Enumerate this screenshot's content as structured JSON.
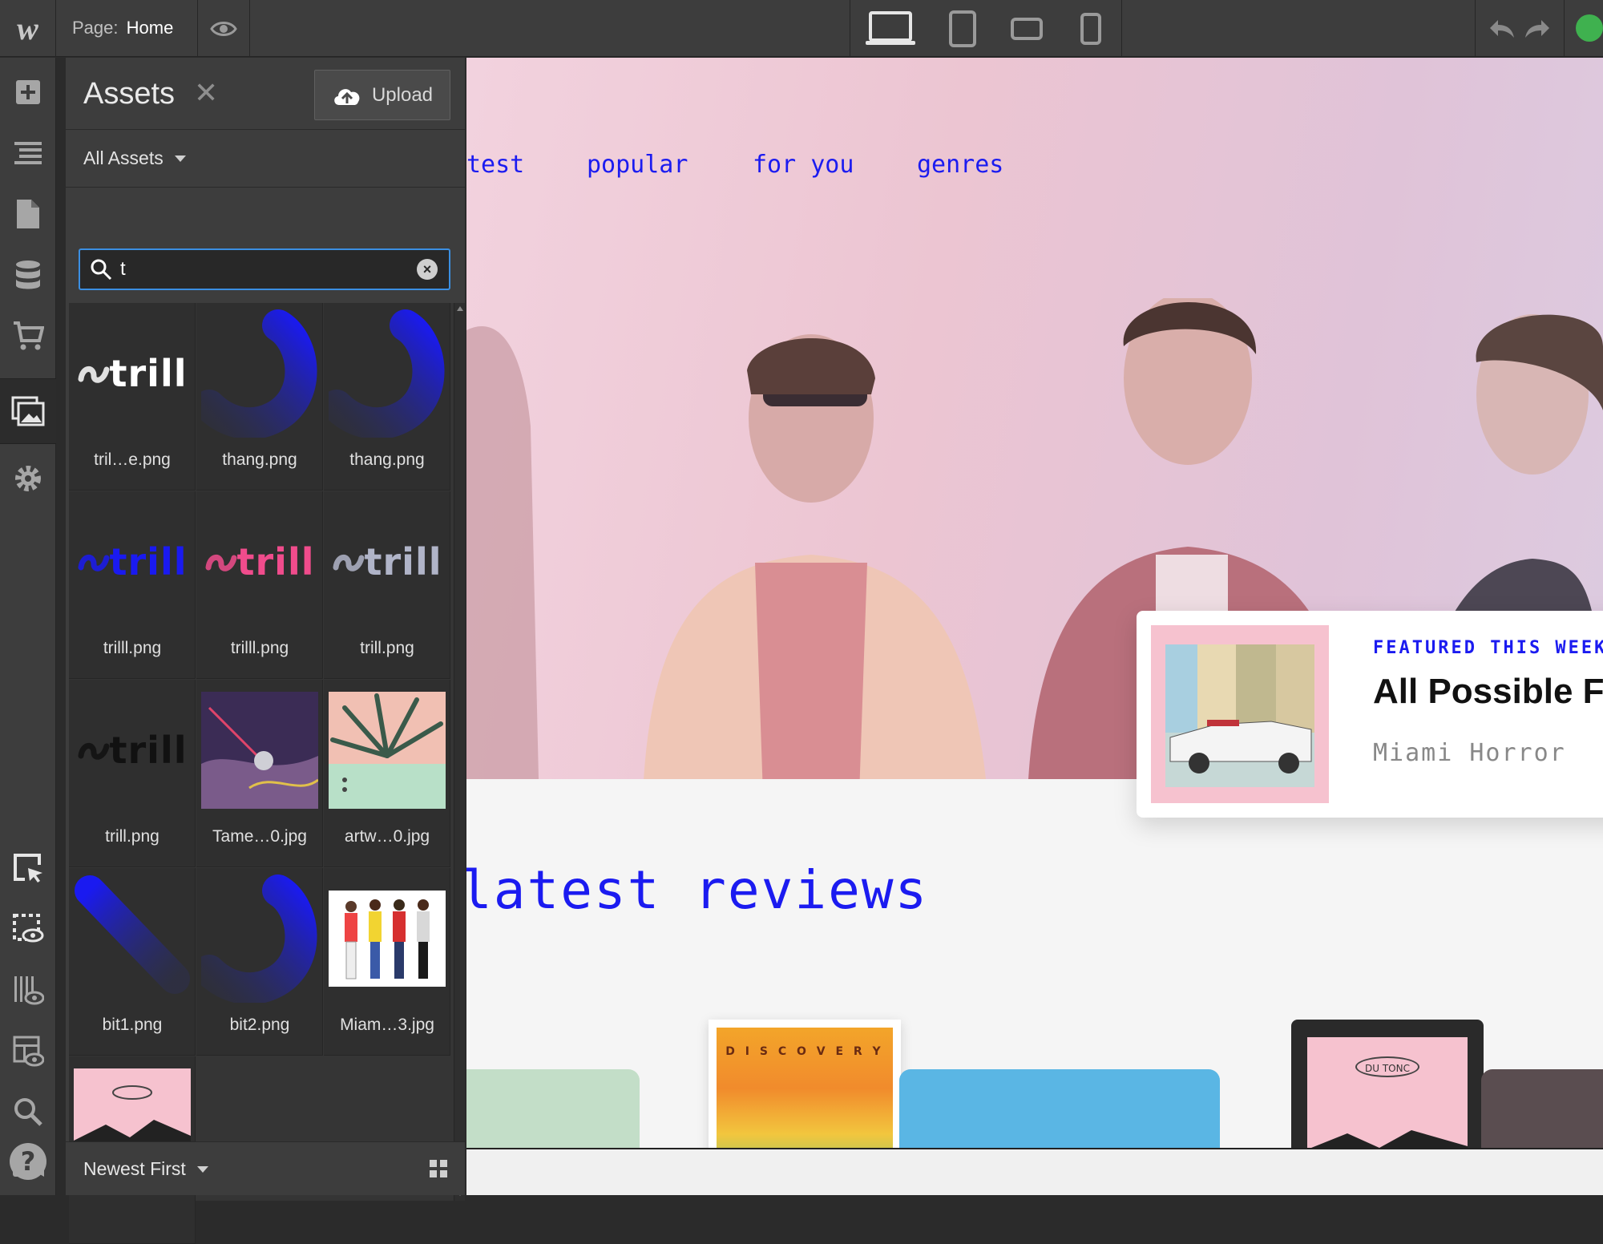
{
  "topbar": {
    "logo": "w",
    "page_prefix": "Page:",
    "page_name": "Home",
    "devices": [
      "desktop-icon",
      "tablet-icon",
      "mobile-landscape-icon",
      "mobile-portrait-icon"
    ],
    "accent": "#3b8fe2",
    "status_color": "#3fb14f"
  },
  "rail": {
    "items": [
      "add-icon",
      "navigator-icon",
      "pages-icon",
      "cms-icon",
      "ecommerce-icon",
      "assets-icon",
      "settings-icon"
    ],
    "bottom_items": [
      "select-mode-icon",
      "preview-element-icon",
      "audit-icon",
      "layout-preview-icon",
      "search-icon",
      "team-icon",
      "help-icon"
    ]
  },
  "assets": {
    "title": "Assets",
    "upload_label": "Upload",
    "filter_label": "All Assets",
    "search_value": "t",
    "sort_label": "Newest First",
    "items": [
      {
        "name": "tril…e.png",
        "kind": "trill",
        "color": "#ffffff"
      },
      {
        "name": "thang.png",
        "kind": "arc",
        "color": "#1a1af0"
      },
      {
        "name": "thang.png",
        "kind": "arc",
        "color": "#1a1af0"
      },
      {
        "name": "trilll.png",
        "kind": "trill",
        "color": "#1a1af0"
      },
      {
        "name": "trilll.png",
        "kind": "trill",
        "color": "#f04c8c"
      },
      {
        "name": "trill.png",
        "kind": "trill",
        "color": "#b0b4c8"
      },
      {
        "name": "trill.png",
        "kind": "trill",
        "color": "#111111"
      },
      {
        "name": "Tame…0.jpg",
        "kind": "photo-tame",
        "color": "#5a3d7a"
      },
      {
        "name": "artw…0.jpg",
        "kind": "photo-palm",
        "color": "#e8b0a8"
      },
      {
        "name": "bit1.png",
        "kind": "stroke",
        "color": "#1a1af0"
      },
      {
        "name": "bit2.png",
        "kind": "arc2",
        "color": "#1a1af0"
      },
      {
        "name": "Miam…3.jpg",
        "kind": "photo-band",
        "color": "#ffffff"
      },
      {
        "name": "",
        "kind": "photo-dutonc",
        "color": "#f6c2cf"
      }
    ],
    "trill_word": "trill"
  },
  "canvas": {
    "nav": [
      "test",
      "popular",
      "for you",
      "genres"
    ],
    "featured": {
      "eyebrow": "FEATURED THIS WEEK",
      "title": "All Possible Fu",
      "artist": "Miami Horror"
    },
    "reviews_title": "latest reviews",
    "discovery_label": "D I S C O V E R Y",
    "dutonc_label": "DU TONC",
    "link_color": "#1b1bf0"
  }
}
